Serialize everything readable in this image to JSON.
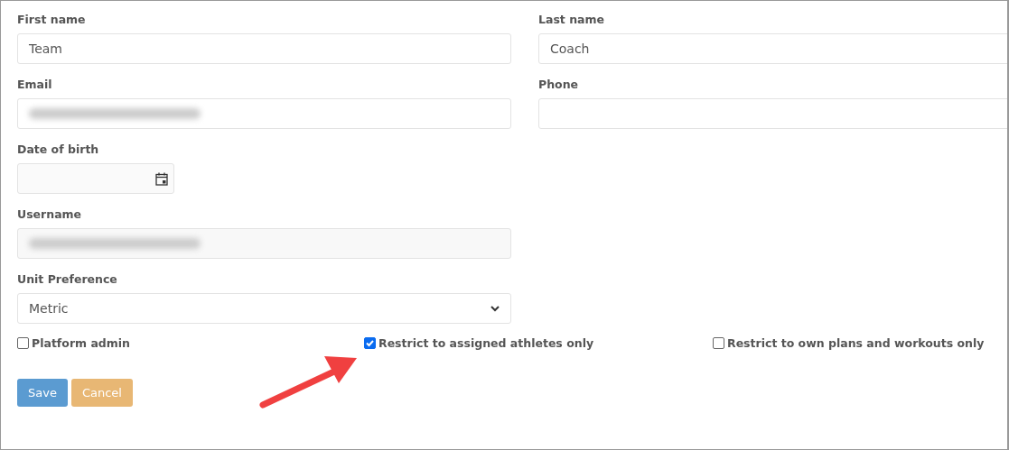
{
  "rows": [
    {
      "fields": [
        {
          "label": "First name",
          "kind": "text",
          "value": "Team"
        },
        {
          "label": "Last name",
          "kind": "text",
          "value": "Coach"
        }
      ]
    },
    {
      "fields": [
        {
          "label": "Email",
          "kind": "text",
          "blurred": true
        },
        {
          "label": "Phone",
          "kind": "text"
        }
      ]
    },
    {
      "fields": [
        {
          "label": "Date of birth",
          "kind": "date"
        }
      ]
    },
    {
      "fields": [
        {
          "label": "Username",
          "kind": "text",
          "blurred": true,
          "disabled": true
        }
      ]
    },
    {
      "fields": [
        {
          "label": "Unit Preference",
          "kind": "select",
          "value": "Metric"
        }
      ]
    }
  ],
  "checkboxes": [
    {
      "label": "Platform admin",
      "checked": false
    },
    {
      "label": "Restrict to assigned athletes only",
      "checked": true
    },
    {
      "label": "Restrict to own plans and workouts only",
      "checked": false
    }
  ],
  "buttons": [
    {
      "label": "Save",
      "kind": "primary"
    },
    {
      "label": "Cancel",
      "kind": "secondary"
    }
  ],
  "annotation": {
    "kind": "arrow"
  }
}
